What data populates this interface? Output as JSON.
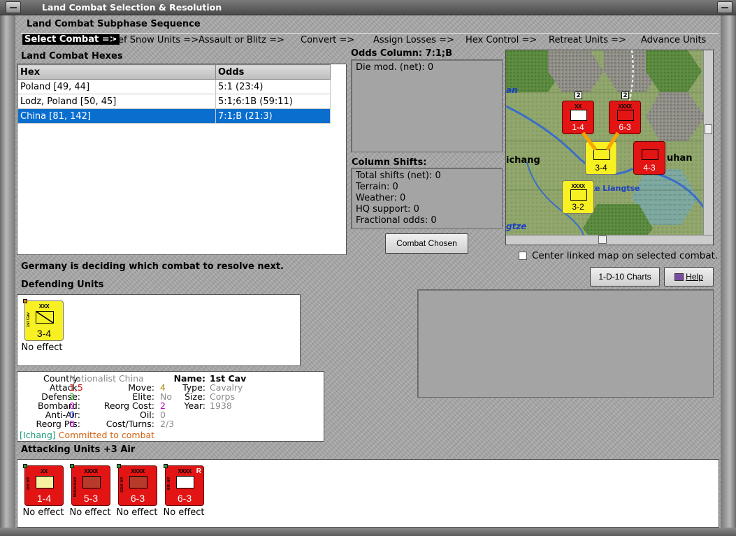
{
  "window": {
    "title": "Land Combat Selection & Resolution"
  },
  "subphase": {
    "label": "Land Combat Subphase Sequence",
    "phases": [
      "Select Combat =>",
      "Def Snow Units =>",
      "Assault or Blitz =>",
      "Convert =>",
      "Assign Losses =>",
      "Hex Control =>",
      "Retreat Units =>",
      "Advance Units"
    ],
    "active_index": 0
  },
  "hexes": {
    "label": "Land Combat Hexes",
    "columns": [
      "Hex",
      "Odds"
    ],
    "rows": [
      [
        "Poland [49, 44]",
        "5:1 (23:4)"
      ],
      [
        "Lodz, Poland [50, 45]",
        "5:1;6:1B (59:11)"
      ],
      [
        "China [81, 142]",
        "7:1;B (21:3)"
      ]
    ],
    "selected_index": 2
  },
  "odds": {
    "label": "Odds Column: 7:1;B",
    "die_mod": "Die mod. (net): 0"
  },
  "shifts": {
    "label": "Column Shifts:",
    "items": [
      "Total shifts (net): 0",
      "Terrain: 0",
      "Weather: 0",
      "HQ support: 0",
      "Fractional odds: 0"
    ]
  },
  "combat_chosen_button": "Combat Chosen",
  "map": {
    "labels": [
      "ichang",
      "uhan",
      "ke Liangtse",
      "an",
      "gtze"
    ],
    "counters": [
      {
        "value": "1-4",
        "size": "XX",
        "color": "red"
      },
      {
        "value": "6-3",
        "size": "XXXX",
        "color": "red"
      },
      {
        "value": "3-4",
        "size": "",
        "color": "yellow"
      },
      {
        "value": "4-3",
        "size": "",
        "color": "red"
      },
      {
        "value": "3-2",
        "size": "XXXX",
        "color": "yellow"
      }
    ],
    "stack_badges": [
      "2",
      "2"
    ]
  },
  "center_map_checkbox": {
    "label": "Center linked map on selected combat.",
    "checked": false
  },
  "status_message": "Germany is deciding which combat to resolve next.",
  "defending": {
    "label": "Defending Units",
    "units": [
      {
        "value": "3-4",
        "size": "XXX",
        "side": "1st Cav",
        "effect": "No effect",
        "color": "yellow"
      }
    ]
  },
  "buttons": {
    "charts": "1-D-10 Charts",
    "help": "Help"
  },
  "unit_info": {
    "country_label": "Country:",
    "country": "Nationalist China",
    "attack_label": "Attack:",
    "attack": "1,5",
    "defense_label": "Defense:",
    "defense": "3",
    "bombard_label": "Bombard:",
    "bombard": "0",
    "antiair_label": "Anti-Air:",
    "antiair": "0",
    "reorg_label": "Reorg Pts:",
    "reorg": "0",
    "move_label": "Move:",
    "move": "4",
    "elite_label": "Elite:",
    "elite": "No",
    "reorg_cost_label": "Reorg Cost:",
    "reorg_cost": "2",
    "oil_label": "Oil:",
    "oil": "0",
    "cost_label": "Cost/Turns:",
    "cost": "2/3",
    "name_label": "Name:",
    "name": "1st Cav",
    "type_label": "Type:",
    "type": "Cavalry",
    "size_label": "Size:",
    "size": "Corps",
    "year_label": "Year:",
    "year": "1938",
    "location": "[Ichang]",
    "status": "Committed to combat",
    "colors": {
      "attack": "#d01010",
      "defense": "#1a9a1a",
      "bombard": "#c000c0",
      "antiair": "#2020d0",
      "move": "#a08800",
      "reorg_cost": "#c000c0",
      "location": "#1a9a7a",
      "status": "#d06010"
    }
  },
  "attacking": {
    "label": "Attacking Units +3 Air",
    "units": [
      {
        "value": "1-4",
        "size": "XX",
        "side": "3rd Inf",
        "effect": "No effect"
      },
      {
        "value": "5-3",
        "size": "XXXX",
        "side": "Motorized",
        "effect": "No effect"
      },
      {
        "value": "6-3",
        "size": "XXXX",
        "side": "23rd Inf",
        "effect": "No effect"
      },
      {
        "value": "6-3",
        "size": "XXXX",
        "side": "6th Inf",
        "effect": "No effect",
        "badge": "R"
      }
    ]
  }
}
